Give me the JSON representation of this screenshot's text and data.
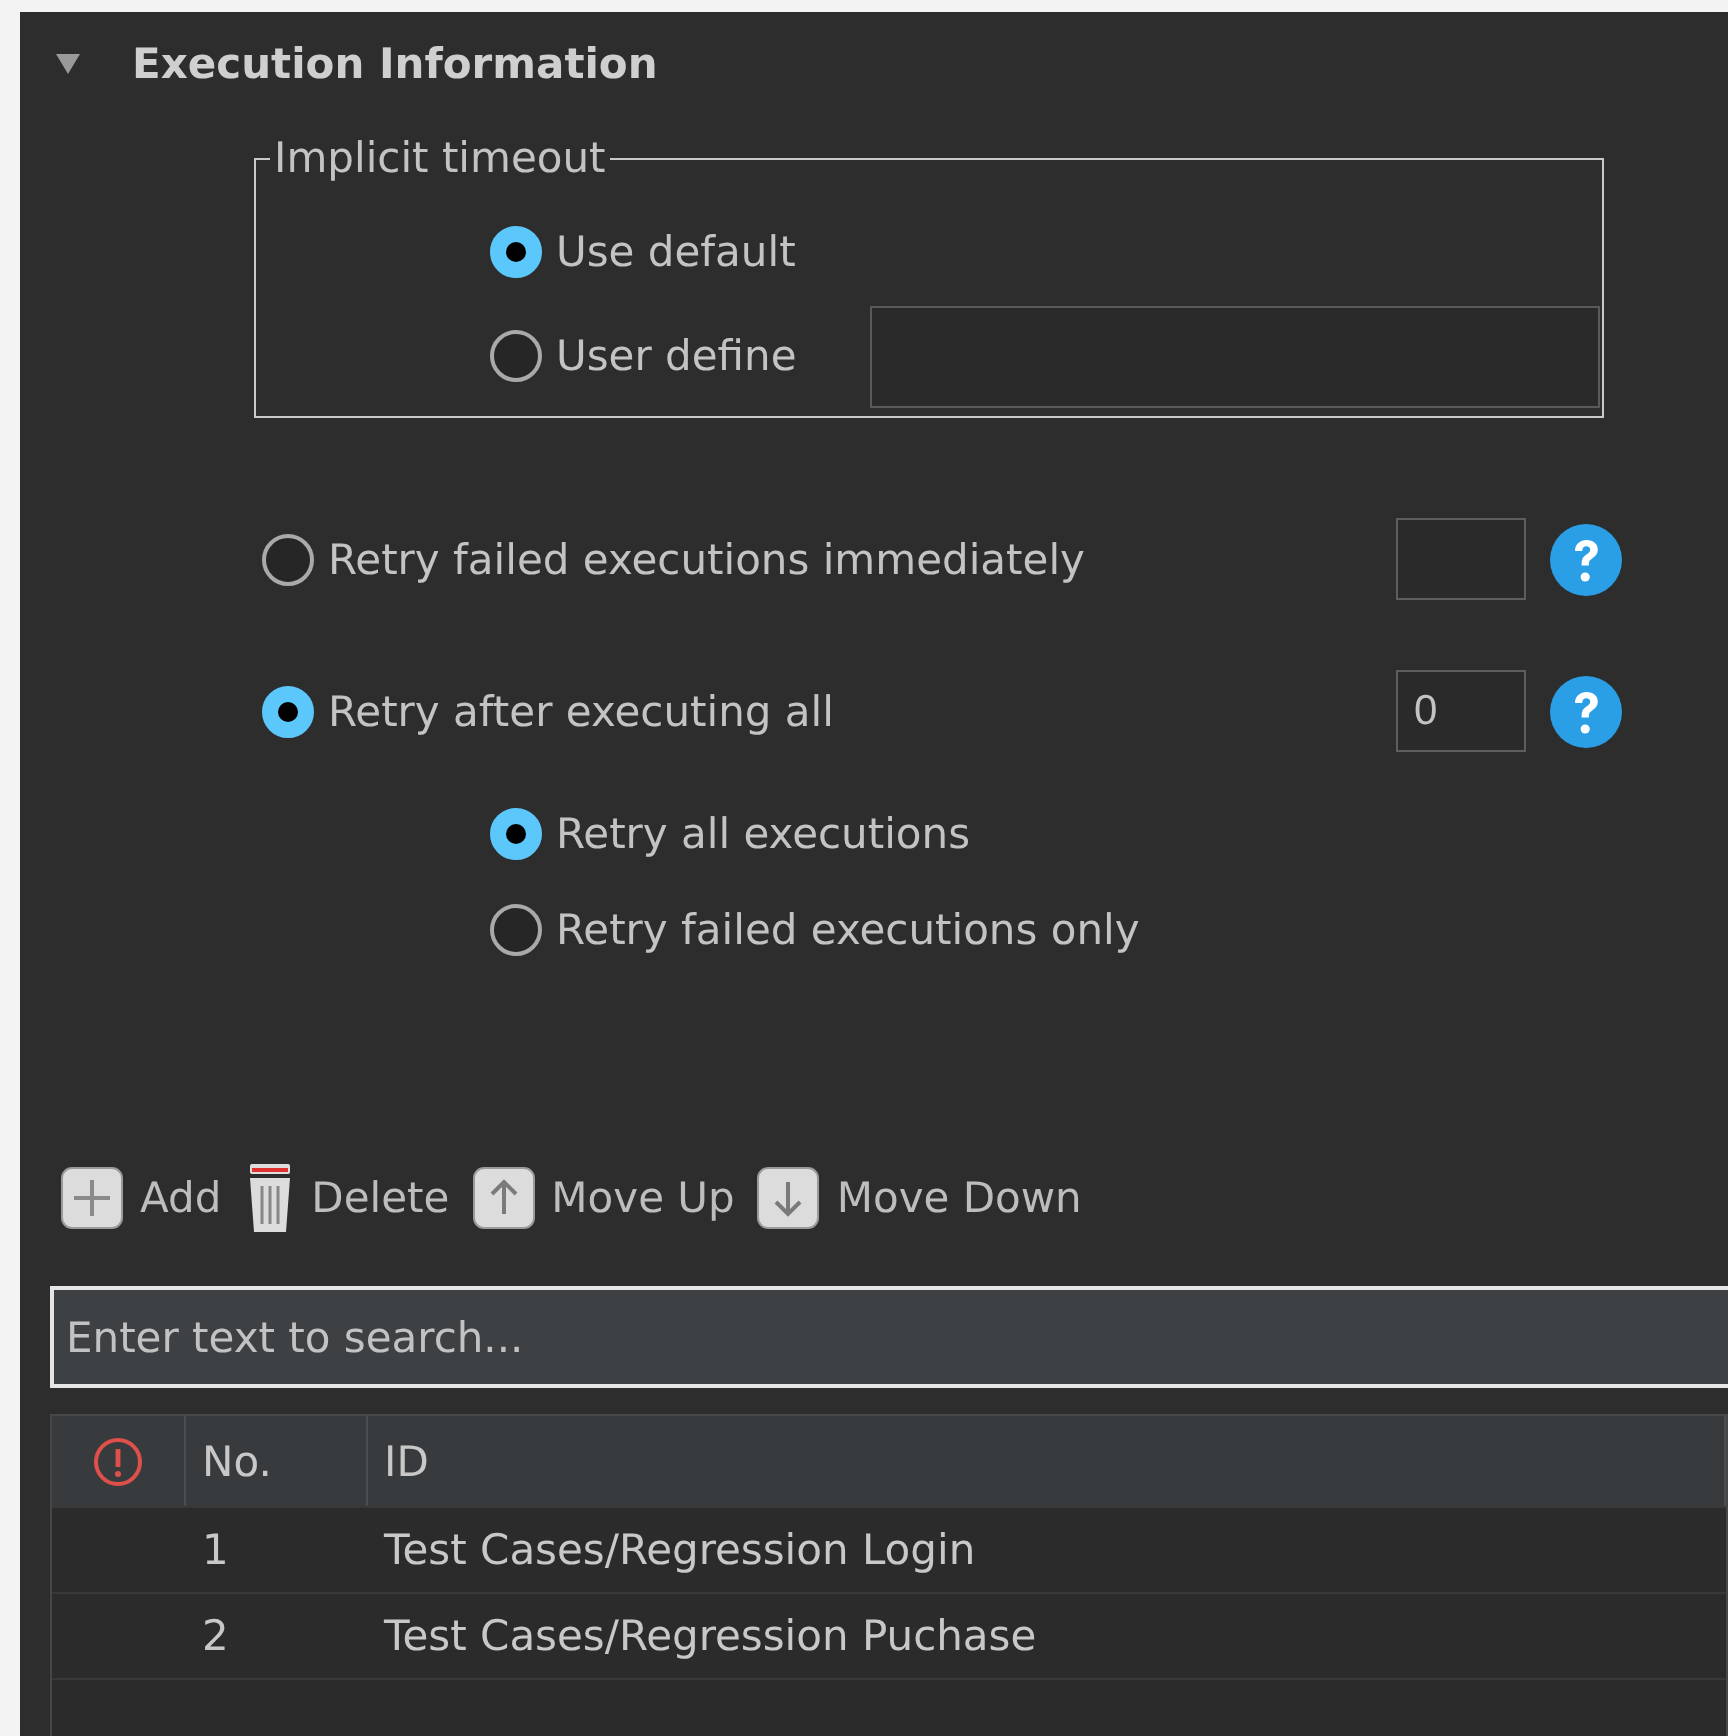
{
  "section": {
    "title": "Execution Information",
    "expanded": true
  },
  "implicit_timeout": {
    "legend": "Implicit timeout",
    "options": [
      {
        "label": "Use default",
        "selected": true,
        "has_field": false
      },
      {
        "label": "User define",
        "selected": false,
        "has_field": true
      }
    ]
  },
  "retry_options": [
    {
      "label": "Retry failed executions immediately",
      "selected": false
    },
    {
      "label": "Retry after executing all",
      "selected": true,
      "value": "0"
    }
  ],
  "retry_modes": [
    {
      "label": "Retry all executions",
      "selected": true
    },
    {
      "label": "Retry failed executions only",
      "selected": false
    }
  ],
  "toolbar": [
    {
      "kind": "add",
      "label": "Add"
    },
    {
      "kind": "delete",
      "label": "Delete"
    },
    {
      "kind": "up",
      "label": "Move Up"
    },
    {
      "kind": "down",
      "label": "Move Down"
    }
  ],
  "search": {
    "placeholder": "Enter text to search..."
  },
  "table": {
    "columns": [
      {
        "kind": "icon"
      },
      {
        "kind": "text",
        "label": "No."
      },
      {
        "kind": "text",
        "label": "ID"
      }
    ],
    "rows": [
      [
        "",
        "1",
        "Test Cases/Regression Login"
      ],
      [
        "",
        "2",
        "Test Cases/Regression Puchase"
      ]
    ]
  }
}
